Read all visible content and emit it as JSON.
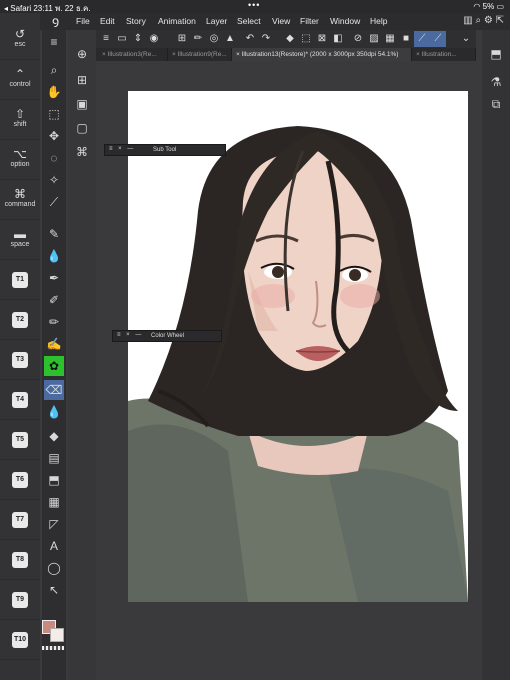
{
  "status_bar": {
    "left": "◂ Safari  23:11  พ. 22 ธ.ค.",
    "dots": "•••",
    "right": "5%"
  },
  "menu": {
    "items": [
      "File",
      "Edit",
      "Story",
      "Animation",
      "Layer",
      "Select",
      "View",
      "Filter",
      "Window",
      "Help"
    ]
  },
  "modifiers": [
    {
      "label": "esc",
      "icon": "undo-icon",
      "glyph": "↺"
    },
    {
      "label": "control",
      "icon": "caret-up-icon",
      "glyph": "⌃"
    },
    {
      "label": "shift",
      "icon": "shift-icon",
      "glyph": "⇧"
    },
    {
      "label": "option",
      "icon": "option-icon",
      "glyph": "⌥"
    },
    {
      "label": "command",
      "icon": "command-icon",
      "glyph": "⌘"
    },
    {
      "label": "space",
      "icon": "space-icon",
      "glyph": "▬"
    }
  ],
  "tkeys": [
    "T1",
    "T2",
    "T3",
    "T4",
    "T5",
    "T6",
    "T7",
    "T8",
    "T9",
    "T10"
  ],
  "tabs": [
    {
      "label": "Illustration3(Re..."
    },
    {
      "label": "Illustration9(Re..."
    },
    {
      "label": "Illustration13(Restore)* (2000 x 3000px 350dpi 54.1%)"
    },
    {
      "label": "Illustration..."
    }
  ],
  "panels": {
    "sub_tool": "Sub Tool",
    "color_wheel": "Color Wheel"
  },
  "colors": {
    "main": "#c98a7e",
    "sub": "#f3ece9",
    "active": "#4a6aa0",
    "highlight": "#2ec12e"
  }
}
